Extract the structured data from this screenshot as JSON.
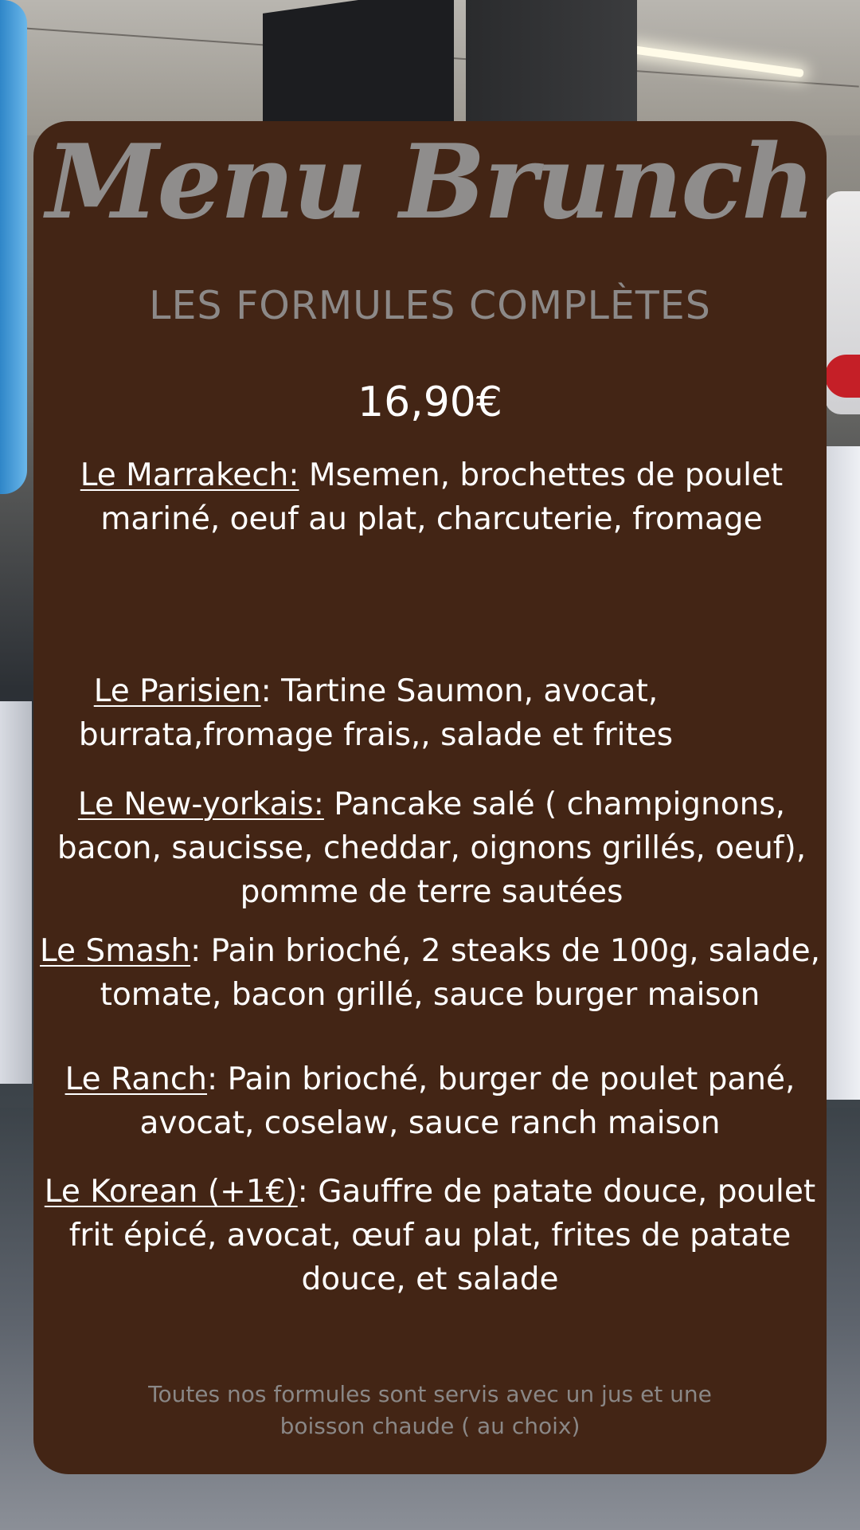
{
  "menu": {
    "title": "Menu Brunch",
    "subtitle": "LES FORMULES COMPLÈTES",
    "price": "16,90€",
    "items": [
      {
        "name": "Le Marrakech:",
        "sep": " ",
        "description": "Msemen, brochettes de poulet mariné, oeuf au plat, charcuterie, fromage"
      },
      {
        "name": "Le Parisien",
        "sep": ": ",
        "description": "Tartine Saumon, avocat, burrata,fromage frais,, salade et frites"
      },
      {
        "name": "Le New-yorkais:",
        "sep": " ",
        "description": "Pancake salé ( champignons, bacon, saucisse, cheddar, oignons grillés, oeuf), pomme de terre sautées"
      },
      {
        "name": "Le Smash",
        "sep": ": ",
        "description": "Pain brioché, 2 steaks de 100g, salade, tomate, bacon grillé, sauce burger maison"
      },
      {
        "name": "Le Ranch",
        "sep": ": ",
        "description": "Pain brioché, burger de poulet pané, avocat, coselaw, sauce ranch maison"
      },
      {
        "name": "Le Korean (+1€)",
        "sep": ": ",
        "description": "Gauffre de patate douce, poulet frit épicé, avocat, œuf au plat, frites de patate douce, et salade"
      }
    ],
    "footer_line1": "Toutes nos formules sont servis avec un jus et une",
    "footer_line2": "boisson chaude ( au choix)"
  }
}
